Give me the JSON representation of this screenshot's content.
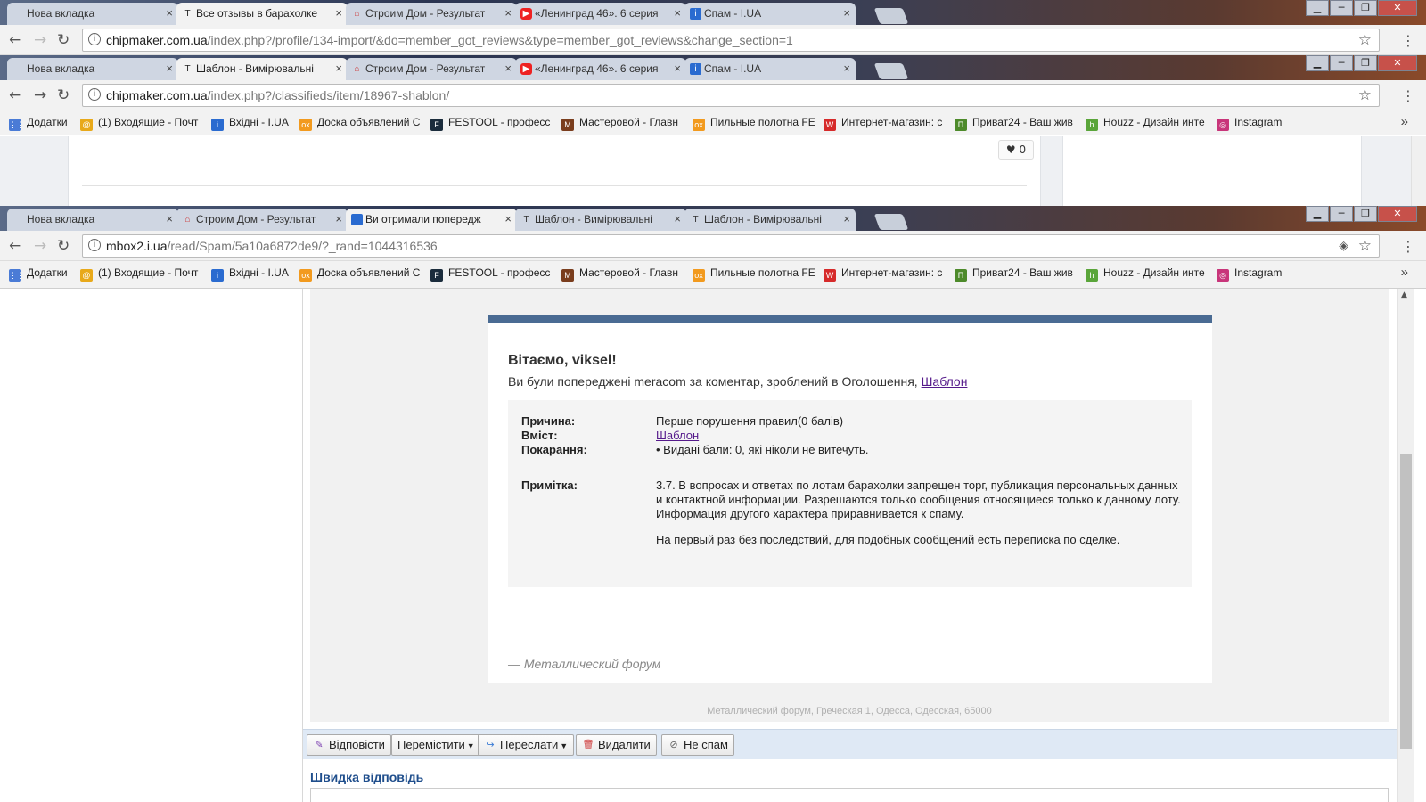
{
  "windows": [
    {
      "tabs": [
        {
          "label": "Нова вкладка",
          "icon": ""
        },
        {
          "label": "Все отзывы в барахолке",
          "icon": "T"
        },
        {
          "label": "Строим Дом - Результат",
          "icon": "⌂"
        },
        {
          "label": "«Ленинград 46». 6 серия",
          "icon": "▶"
        },
        {
          "label": "Спам - I.UA",
          "icon": "i"
        }
      ],
      "url_host": "chipmaker.com.ua",
      "url_path": "/index.php?/profile/134-import/&do=member_got_reviews&type=member_got_reviews&change_section=1"
    },
    {
      "tabs": [
        {
          "label": "Нова вкладка",
          "icon": ""
        },
        {
          "label": "Шаблон - Вимірювальні",
          "icon": "T"
        },
        {
          "label": "Строим Дом - Результат",
          "icon": "⌂"
        },
        {
          "label": "«Ленинград 46». 6 серия",
          "icon": "▶"
        },
        {
          "label": "Спам - I.UA",
          "icon": "i"
        }
      ],
      "url_host": "chipmaker.com.ua",
      "url_path": "/index.php?/classifieds/item/18967-shablon/"
    },
    {
      "tabs": [
        {
          "label": "Нова вкладка",
          "icon": ""
        },
        {
          "label": "Строим Дом - Результат",
          "icon": "⌂"
        },
        {
          "label": "Ви отримали попередж",
          "icon": "i"
        },
        {
          "label": "Шаблон - Вимірювальні",
          "icon": "T"
        },
        {
          "label": "Шаблон - Вимірювальні",
          "icon": "T"
        }
      ],
      "url_host": "mbox2.i.ua",
      "url_path": "/read/Spam/5a10a6872de9/?_rand=1044316536"
    }
  ],
  "bookmarks": [
    {
      "label": "Додатки",
      "icon": "⋮⋮",
      "color": "#4a7bd6"
    },
    {
      "label": "(1) Входящие - Почт",
      "icon": "@",
      "color": "#e8a91a"
    },
    {
      "label": "Вхідні - I.UA",
      "icon": "i",
      "color": "#2a6bd0"
    },
    {
      "label": "Доска объявлений С",
      "icon": "ох",
      "color": "#f29a1e"
    },
    {
      "label": "FESTOOL - професс",
      "icon": "F",
      "color": "#1b2c3c"
    },
    {
      "label": "Мастеровой - Главн",
      "icon": "M",
      "color": "#7a3d1d"
    },
    {
      "label": "Пильные полотна FE",
      "icon": "ох",
      "color": "#f29a1e"
    },
    {
      "label": "Интернет-магазин: с",
      "icon": "W",
      "color": "#d62a2a"
    },
    {
      "label": "Приват24 - Ваш жив",
      "icon": "П",
      "color": "#4d8a2a"
    },
    {
      "label": "Houzz - Дизайн инте",
      "icon": "h",
      "color": "#5aa53a"
    },
    {
      "label": "Instagram",
      "icon": "◎",
      "color": "#c8357a"
    }
  ],
  "page1": {
    "like_count": "0"
  },
  "mail": {
    "greeting": "Вітаємо, viksel!",
    "intro_text": "Ви були попереджені meracom за коментар, зроблений в Оголошення, ",
    "intro_link": "Шаблон",
    "reason_label": "Причина:",
    "reason_value": "Перше порушення правил(0 балів)",
    "content_label": "Вміст:",
    "content_value": "Шаблон",
    "penalty_label": "Покарання:",
    "penalty_value": "Видані бали: 0, які ніколи не витечуть.",
    "note_label": "Примітка:",
    "note_p1": "3.7. В вопросах и ответах по лотам барахолки запрещен торг, публикация персональных данных и контактной информации. Разрешаются только сообщения относящиеся только к данному лоту. Информация другого характера приравнивается к спаму.",
    "note_p2": "На первый раз без последствий, для подобных сообщений есть переписка по сделке.",
    "signature": "— Металлический форум",
    "footer_address": "Металлический форум, Греческая 1, Одесса, Одесская, 65000"
  },
  "actions": {
    "reply": "Відповісти",
    "move": "Перемістити",
    "forward": "Переслати",
    "delete": "Видалити",
    "not_spam": "Не спам"
  },
  "quick_reply_title": "Швидка відповідь"
}
